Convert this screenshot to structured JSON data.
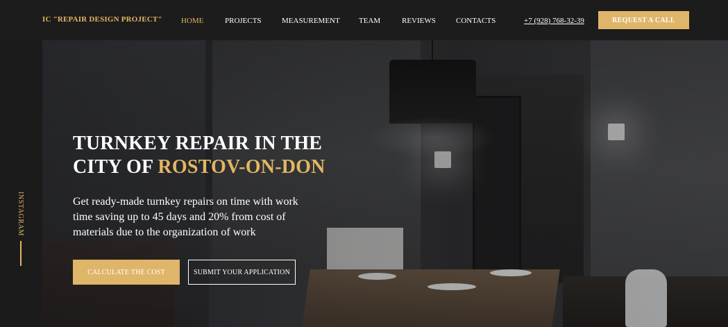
{
  "header": {
    "logo": "IC \"REPAIR DESIGN PROJECT\"",
    "nav": [
      {
        "label": "HOME",
        "active": true
      },
      {
        "label": "PROJECTS",
        "active": false
      },
      {
        "label": "MEASUREMENT",
        "active": false
      },
      {
        "label": "TEAM",
        "active": false
      },
      {
        "label": "REVIEWS",
        "active": false
      },
      {
        "label": "CONTACTS",
        "active": false
      }
    ],
    "phone": "+7 (928) 768-32-39",
    "cta_label": "REQUEST A CALL"
  },
  "side": {
    "social_label": "INSTAGRAM"
  },
  "hero": {
    "title_line1": "TURNKEY REPAIR IN THE",
    "title_line2_prefix": "CITY OF ",
    "title_line2_accent": "ROSTOV-ON-DON",
    "subtitle": "Get ready-made turnkey repairs on time with work time saving up to 45 days and 20% from cost of materials due to the organization of work",
    "primary_button": "CALCULATE THE COST",
    "secondary_button": "SUBMIT YOUR APPLICATION"
  },
  "colors": {
    "accent": "#dfb56a",
    "background": "#1c1c1c",
    "text": "#ffffff"
  }
}
